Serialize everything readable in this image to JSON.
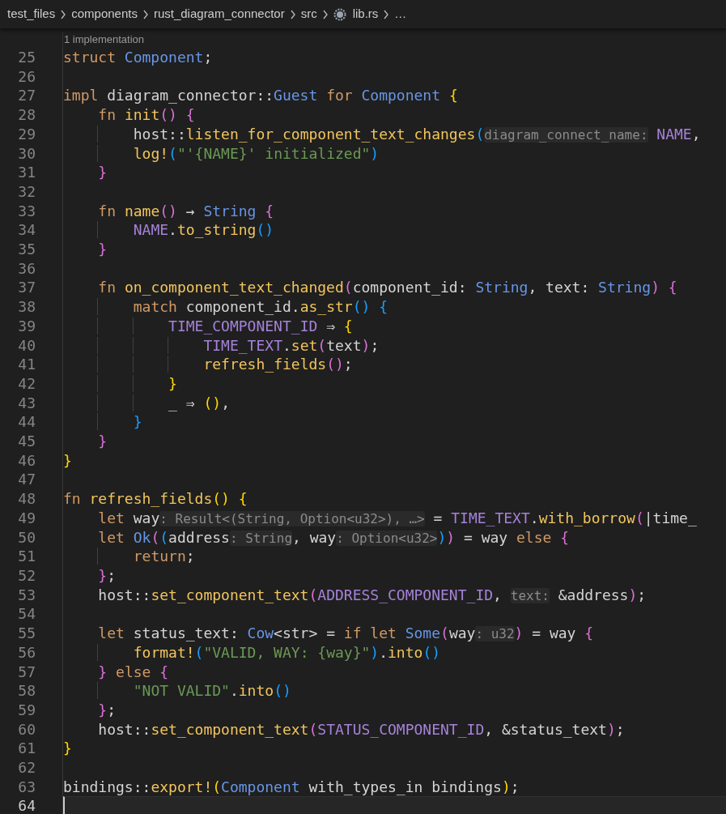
{
  "breadcrumb": [
    {
      "kind": "folder",
      "text": "test_files"
    },
    {
      "kind": "folder",
      "text": "components"
    },
    {
      "kind": "folder",
      "text": "rust_diagram_connector"
    },
    {
      "kind": "folder",
      "text": "src"
    },
    {
      "kind": "file",
      "text": "lib.rs"
    },
    {
      "kind": "more",
      "text": "…"
    }
  ],
  "lines": [
    {
      "number": "25",
      "current": false,
      "codelens": "1 implementation",
      "tokens": [
        {
          "kind": "kw",
          "text": "struct "
        },
        {
          "kind": "type",
          "text": "Component"
        },
        {
          "kind": "p",
          "text": ";"
        }
      ]
    },
    {
      "number": "26",
      "current": false
    },
    {
      "number": "27",
      "current": false,
      "tokens": [
        {
          "kind": "kw",
          "text": "impl"
        },
        {
          "kind": "p",
          "text": " diagram_connector::"
        },
        {
          "kind": "type",
          "text": "Guest "
        },
        {
          "kind": "kw",
          "text": "for "
        },
        {
          "kind": "type",
          "text": "Component "
        },
        {
          "kind": "b1",
          "text": "{"
        }
      ]
    },
    {
      "number": "28",
      "current": false,
      "tokens": [
        {
          "kind": "kw",
          "text": "    fn "
        },
        {
          "kind": "fn",
          "text": "init"
        },
        {
          "kind": "b2",
          "text": "() "
        },
        {
          "kind": "b2",
          "text": "{"
        }
      ]
    },
    {
      "number": "29",
      "current": false,
      "tokens": [
        {
          "kind": "p",
          "text": "        host::"
        },
        {
          "kind": "fn",
          "text": "listen_for_component_text_changes"
        },
        {
          "kind": "b3",
          "text": "("
        },
        {
          "kind": "hint",
          "text": "diagram_connect_name:"
        },
        {
          "kind": "const",
          "text": " NAME"
        },
        {
          "kind": "p",
          "text": ","
        }
      ]
    },
    {
      "number": "30",
      "current": false,
      "tokens": [
        {
          "kind": "fn",
          "text": "        log!"
        },
        {
          "kind": "b3",
          "text": "("
        },
        {
          "kind": "str",
          "text": "\"'{NAME}' initialized\""
        },
        {
          "kind": "b3",
          "text": ")"
        }
      ]
    },
    {
      "number": "31",
      "current": false,
      "tokens": [
        {
          "kind": "b2",
          "text": "    }"
        }
      ]
    },
    {
      "number": "32",
      "current": false
    },
    {
      "number": "33",
      "current": false,
      "tokens": [
        {
          "kind": "kw",
          "text": "    fn "
        },
        {
          "kind": "fn",
          "text": "name"
        },
        {
          "kind": "b2",
          "text": "()"
        },
        {
          "kind": "p",
          "text": " → "
        },
        {
          "kind": "type",
          "text": "String "
        },
        {
          "kind": "b2",
          "text": "{"
        }
      ]
    },
    {
      "number": "34",
      "current": false,
      "tokens": [
        {
          "kind": "const",
          "text": "        NAME"
        },
        {
          "kind": "p",
          "text": "."
        },
        {
          "kind": "fn",
          "text": "to_string"
        },
        {
          "kind": "b3",
          "text": "()"
        }
      ]
    },
    {
      "number": "35",
      "current": false,
      "tokens": [
        {
          "kind": "b2",
          "text": "    }"
        }
      ]
    },
    {
      "number": "36",
      "current": false
    },
    {
      "number": "37",
      "current": false,
      "tokens": [
        {
          "kind": "kw",
          "text": "    fn "
        },
        {
          "kind": "fn",
          "text": "on_component_text_changed"
        },
        {
          "kind": "b2",
          "text": "("
        },
        {
          "kind": "p",
          "text": "component_id: "
        },
        {
          "kind": "type",
          "text": "String"
        },
        {
          "kind": "p",
          "text": ", text: "
        },
        {
          "kind": "type",
          "text": "String"
        },
        {
          "kind": "b2",
          "text": ") "
        },
        {
          "kind": "b2",
          "text": "{"
        }
      ]
    },
    {
      "number": "38",
      "current": false,
      "tokens": [
        {
          "kind": "kw",
          "text": "        match"
        },
        {
          "kind": "p",
          "text": " component_id."
        },
        {
          "kind": "fn",
          "text": "as_str"
        },
        {
          "kind": "b3",
          "text": "() "
        },
        {
          "kind": "b3",
          "text": "{"
        }
      ]
    },
    {
      "number": "39",
      "current": false,
      "tokens": [
        {
          "kind": "const",
          "text": "            TIME_COMPONENT_ID"
        },
        {
          "kind": "p",
          "text": " ⇒ "
        },
        {
          "kind": "b1",
          "text": "{"
        }
      ]
    },
    {
      "number": "40",
      "current": false,
      "tokens": [
        {
          "kind": "const",
          "text": "                TIME_TEXT"
        },
        {
          "kind": "p",
          "text": "."
        },
        {
          "kind": "fn",
          "text": "set"
        },
        {
          "kind": "b2",
          "text": "("
        },
        {
          "kind": "p",
          "text": "text"
        },
        {
          "kind": "b2",
          "text": ")"
        },
        {
          "kind": "p",
          "text": ";"
        }
      ]
    },
    {
      "number": "41",
      "current": false,
      "tokens": [
        {
          "kind": "fn",
          "text": "                refresh_fields"
        },
        {
          "kind": "b2",
          "text": "()"
        },
        {
          "kind": "p",
          "text": ";"
        }
      ]
    },
    {
      "number": "42",
      "current": false,
      "tokens": [
        {
          "kind": "b1",
          "text": "            }"
        }
      ]
    },
    {
      "number": "43",
      "current": false,
      "tokens": [
        {
          "kind": "p",
          "text": "            _ ⇒ "
        },
        {
          "kind": "b1",
          "text": "()"
        },
        {
          "kind": "p",
          "text": ","
        }
      ]
    },
    {
      "number": "44",
      "current": false,
      "tokens": [
        {
          "kind": "b3",
          "text": "        }"
        }
      ]
    },
    {
      "number": "45",
      "current": false,
      "tokens": [
        {
          "kind": "b2",
          "text": "    }"
        }
      ]
    },
    {
      "number": "46",
      "current": false,
      "tokens": [
        {
          "kind": "b1",
          "text": "}"
        }
      ]
    },
    {
      "number": "47",
      "current": false
    },
    {
      "number": "48",
      "current": false,
      "tokens": [
        {
          "kind": "kw",
          "text": "fn "
        },
        {
          "kind": "fn",
          "text": "refresh_fields"
        },
        {
          "kind": "b1",
          "text": "() "
        },
        {
          "kind": "b1",
          "text": "{"
        }
      ]
    },
    {
      "number": "49",
      "current": false,
      "tokens": [
        {
          "kind": "kw",
          "text": "    let"
        },
        {
          "kind": "p",
          "text": " way"
        },
        {
          "kind": "hint",
          "text": ": Result<(String, Option<u32>), …>"
        },
        {
          "kind": "p",
          "text": " = "
        },
        {
          "kind": "const",
          "text": "TIME_TEXT"
        },
        {
          "kind": "p",
          "text": "."
        },
        {
          "kind": "fn",
          "text": "with_borrow"
        },
        {
          "kind": "b2",
          "text": "("
        },
        {
          "kind": "p",
          "text": "|time_"
        }
      ]
    },
    {
      "number": "50",
      "current": false,
      "tokens": [
        {
          "kind": "kw",
          "text": "    let "
        },
        {
          "kind": "type",
          "text": "Ok"
        },
        {
          "kind": "b2",
          "text": "("
        },
        {
          "kind": "b3",
          "text": "("
        },
        {
          "kind": "p",
          "text": "address"
        },
        {
          "kind": "hint",
          "text": ": String"
        },
        {
          "kind": "p",
          "text": ", way"
        },
        {
          "kind": "hint",
          "text": ": Option<u32>"
        },
        {
          "kind": "b3",
          "text": ")"
        },
        {
          "kind": "b2",
          "text": ")"
        },
        {
          "kind": "p",
          "text": " = way "
        },
        {
          "kind": "kw",
          "text": "else "
        },
        {
          "kind": "b2",
          "text": "{"
        }
      ]
    },
    {
      "number": "51",
      "current": false,
      "tokens": [
        {
          "kind": "kw",
          "text": "        return"
        },
        {
          "kind": "p",
          "text": ";"
        }
      ]
    },
    {
      "number": "52",
      "current": false,
      "tokens": [
        {
          "kind": "b2",
          "text": "    }"
        },
        {
          "kind": "p",
          "text": ";"
        }
      ]
    },
    {
      "number": "53",
      "current": false,
      "tokens": [
        {
          "kind": "p",
          "text": "    host::"
        },
        {
          "kind": "fn",
          "text": "set_component_text"
        },
        {
          "kind": "b2",
          "text": "("
        },
        {
          "kind": "const",
          "text": "ADDRESS_COMPONENT_ID"
        },
        {
          "kind": "p",
          "text": ", "
        },
        {
          "kind": "hint",
          "text": "text:"
        },
        {
          "kind": "p",
          "text": " &address"
        },
        {
          "kind": "b2",
          "text": ")"
        },
        {
          "kind": "p",
          "text": ";"
        }
      ]
    },
    {
      "number": "54",
      "current": false
    },
    {
      "number": "55",
      "current": false,
      "tokens": [
        {
          "kind": "kw",
          "text": "    let"
        },
        {
          "kind": "p",
          "text": " status_text: "
        },
        {
          "kind": "type",
          "text": "Cow"
        },
        {
          "kind": "p",
          "text": "<str> = "
        },
        {
          "kind": "kw",
          "text": "if let "
        },
        {
          "kind": "type",
          "text": "Some"
        },
        {
          "kind": "b2",
          "text": "("
        },
        {
          "kind": "p",
          "text": "way"
        },
        {
          "kind": "hint",
          "text": ": u32"
        },
        {
          "kind": "b2",
          "text": ")"
        },
        {
          "kind": "p",
          "text": " = way "
        },
        {
          "kind": "b2",
          "text": "{"
        }
      ]
    },
    {
      "number": "56",
      "current": false,
      "tokens": [
        {
          "kind": "fn",
          "text": "        format!"
        },
        {
          "kind": "b3",
          "text": "("
        },
        {
          "kind": "str",
          "text": "\"VALID, WAY: {way}\""
        },
        {
          "kind": "b3",
          "text": ")"
        },
        {
          "kind": "p",
          "text": "."
        },
        {
          "kind": "fn",
          "text": "into"
        },
        {
          "kind": "b3",
          "text": "()"
        }
      ]
    },
    {
      "number": "57",
      "current": false,
      "tokens": [
        {
          "kind": "b2",
          "text": "    } "
        },
        {
          "kind": "kw",
          "text": "else "
        },
        {
          "kind": "b2",
          "text": "{"
        }
      ]
    },
    {
      "number": "58",
      "current": false,
      "tokens": [
        {
          "kind": "str",
          "text": "        \"NOT VALID\""
        },
        {
          "kind": "p",
          "text": "."
        },
        {
          "kind": "fn",
          "text": "into"
        },
        {
          "kind": "b3",
          "text": "()"
        }
      ]
    },
    {
      "number": "59",
      "current": false,
      "tokens": [
        {
          "kind": "b2",
          "text": "    }"
        },
        {
          "kind": "p",
          "text": ";"
        }
      ]
    },
    {
      "number": "60",
      "current": false,
      "tokens": [
        {
          "kind": "p",
          "text": "    host::"
        },
        {
          "kind": "fn",
          "text": "set_component_text"
        },
        {
          "kind": "b2",
          "text": "("
        },
        {
          "kind": "const",
          "text": "STATUS_COMPONENT_ID"
        },
        {
          "kind": "p",
          "text": ", &status_text"
        },
        {
          "kind": "b2",
          "text": ")"
        },
        {
          "kind": "p",
          "text": ";"
        }
      ]
    },
    {
      "number": "61",
      "current": false,
      "tokens": [
        {
          "kind": "b1",
          "text": "}"
        }
      ]
    },
    {
      "number": "62",
      "current": false
    },
    {
      "number": "63",
      "current": false,
      "tokens": [
        {
          "kind": "p",
          "text": "bindings::"
        },
        {
          "kind": "fn",
          "text": "export!"
        },
        {
          "kind": "b1",
          "text": "("
        },
        {
          "kind": "type",
          "text": "Component"
        },
        {
          "kind": "p",
          "text": " with_types_in bindings"
        },
        {
          "kind": "b1",
          "text": ")"
        },
        {
          "kind": "p",
          "text": ";"
        }
      ]
    },
    {
      "number": "64",
      "current": true
    }
  ]
}
